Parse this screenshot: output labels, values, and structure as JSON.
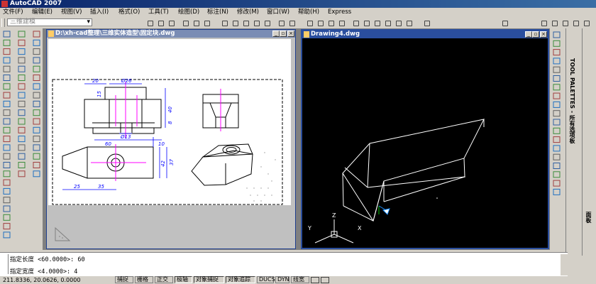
{
  "app": {
    "title": "AutoCAD 2007"
  },
  "menu": [
    "文件(F)",
    "编辑(E)",
    "视图(V)",
    "插入(I)",
    "格式(O)",
    "工具(T)",
    "绘图(D)",
    "标注(N)",
    "修改(M)",
    "窗口(W)",
    "帮助(H)",
    "Express"
  ],
  "workspace_select": {
    "value": "三维建模"
  },
  "windows": {
    "left": {
      "title": "D:\\xh-cad整理\\三维实体造型\\固定块.dwg"
    },
    "right": {
      "title": "Drawing4.dwg"
    }
  },
  "drawing": {
    "dims": {
      "d20": "20",
      "d26": "Ø26",
      "d15": "15",
      "d40": "40",
      "d8": "8",
      "d13": "Ø13",
      "d60": "60",
      "d10": "10",
      "d37": "37",
      "d25": "25",
      "d35": "35",
      "d42": "42"
    }
  },
  "ucs": {
    "x": "X",
    "y": "Y",
    "z": "Z"
  },
  "palettes": {
    "tool": "TOOL PALETTES - 所有选项板",
    "side": "面板"
  },
  "command": {
    "line1": "指定长度 <60.0000>: 60",
    "line2": "指定宽度 <4.0000>: 4"
  },
  "status": {
    "coords": "211.8336, 20.0626, 0.0000",
    "buttons": [
      "捕捉",
      "栅格",
      "正交",
      "极轴",
      "对象捕捉",
      "对象追踪",
      "DUCS",
      "DYN",
      "线宽"
    ],
    "on": [
      false,
      false,
      false,
      true,
      true,
      true,
      false,
      false,
      false
    ]
  },
  "colors": {
    "title_bar": "#0a246a",
    "active_title": "#2a4e9e",
    "inactive_title": "#7a8cb4",
    "model_bg": "#000000",
    "wire": "#ffffff",
    "dim": "#0000ff",
    "center": "#ff00ff"
  }
}
